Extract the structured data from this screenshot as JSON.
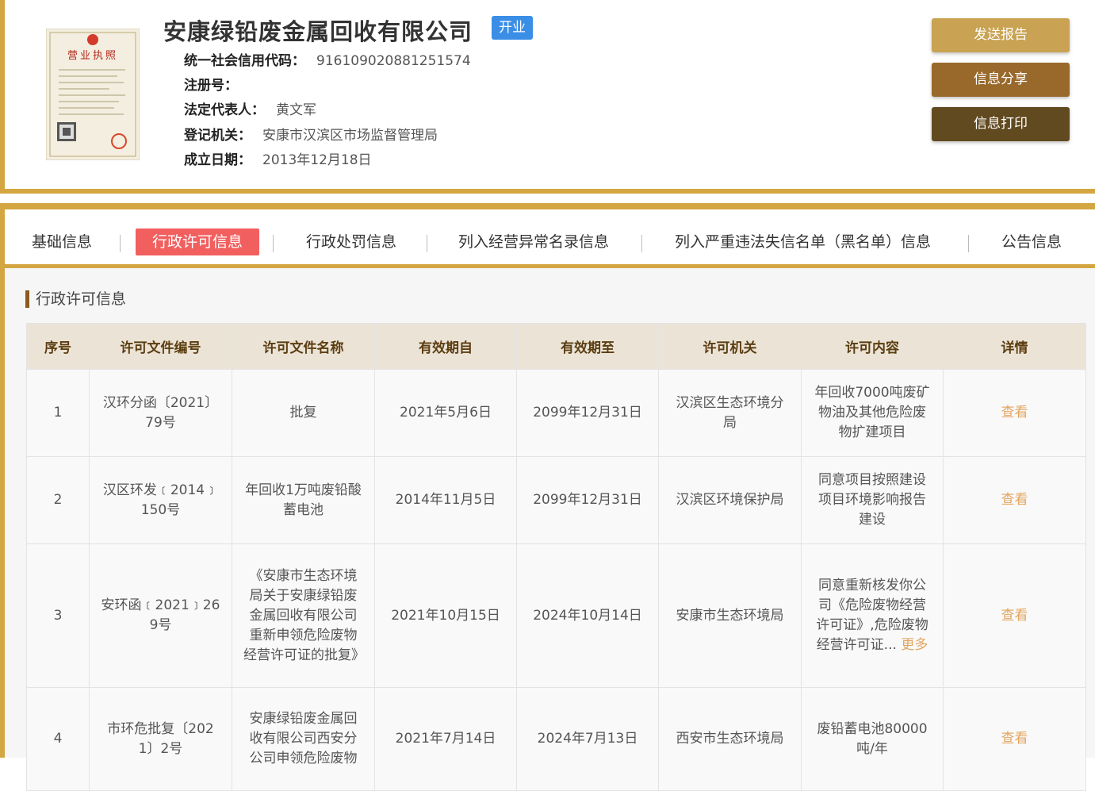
{
  "company": {
    "name": "安康绿铅废金属回收有限公司",
    "status": "开业",
    "fields": [
      {
        "label": "统一社会信用代码：",
        "value": "916109020881251574"
      },
      {
        "label": "注册号：",
        "value": ""
      },
      {
        "label": "法定代表人：",
        "value": "黄文军"
      },
      {
        "label": "登记机关：",
        "value": "安康市汉滨区市场监督管理局"
      },
      {
        "label": "成立日期：",
        "value": "2013年12月18日"
      }
    ]
  },
  "license_image": {
    "title": "营业执照"
  },
  "actions": {
    "send": "发送报告",
    "share": "信息分享",
    "print": "信息打印"
  },
  "tabs": [
    "基础信息",
    "行政许可信息",
    "行政处罚信息",
    "列入经营异常名录信息",
    "列入严重违法失信名单（黑名单）信息",
    "公告信息"
  ],
  "active_tab": "行政许可信息",
  "section": {
    "title": "行政许可信息"
  },
  "table": {
    "headers": [
      "序号",
      "许可文件编号",
      "许可文件名称",
      "有效期自",
      "有效期至",
      "许可机关",
      "许可内容",
      "详情"
    ],
    "rows": [
      {
        "no": "1",
        "code": "汉环分函〔2021〕79号",
        "name": "批复",
        "from": "2021年5月6日",
        "to": "2099年12月31日",
        "org": "汉滨区生态环境分局",
        "content": "年回收7000吨废矿物油及其他危险废物扩建项目",
        "more": "",
        "detail": "查看"
      },
      {
        "no": "2",
        "code": "汉区环发﹝2014﹞150号",
        "name": "年回收1万吨废铅酸蓄电池",
        "from": "2014年11月5日",
        "to": "2099年12月31日",
        "org": "汉滨区环境保护局",
        "content": "同意项目按照建设项目环境影响报告建设",
        "more": "",
        "detail": "查看"
      },
      {
        "no": "3",
        "code": "安环函﹝2021﹞269号",
        "name": "《安康市生态环境局关于安康绿铅废金属回收有限公司重新申领危险废物经营许可证的批复》",
        "from": "2021年10月15日",
        "to": "2024年10月14日",
        "org": "安康市生态环境局",
        "content": "同意重新核发你公司《危险废物经营许可证》,危险废物经营许可证...",
        "more": "更多",
        "detail": "查看"
      },
      {
        "no": "4",
        "code": "市环危批复〔2021〕2号",
        "name": "安康绿铅废金属回收有限公司西安分公司申领危险废物",
        "from": "2021年7月14日",
        "to": "2024年7月13日",
        "org": "西安市生态环境局",
        "content": "废铅蓄电池80000吨/年",
        "more": "",
        "detail": "查看"
      }
    ]
  },
  "colors": {
    "gold": "#d4a641",
    "badge": "#3a8ee6",
    "active_tab": "#f25f5f",
    "link": "#e3a560"
  }
}
